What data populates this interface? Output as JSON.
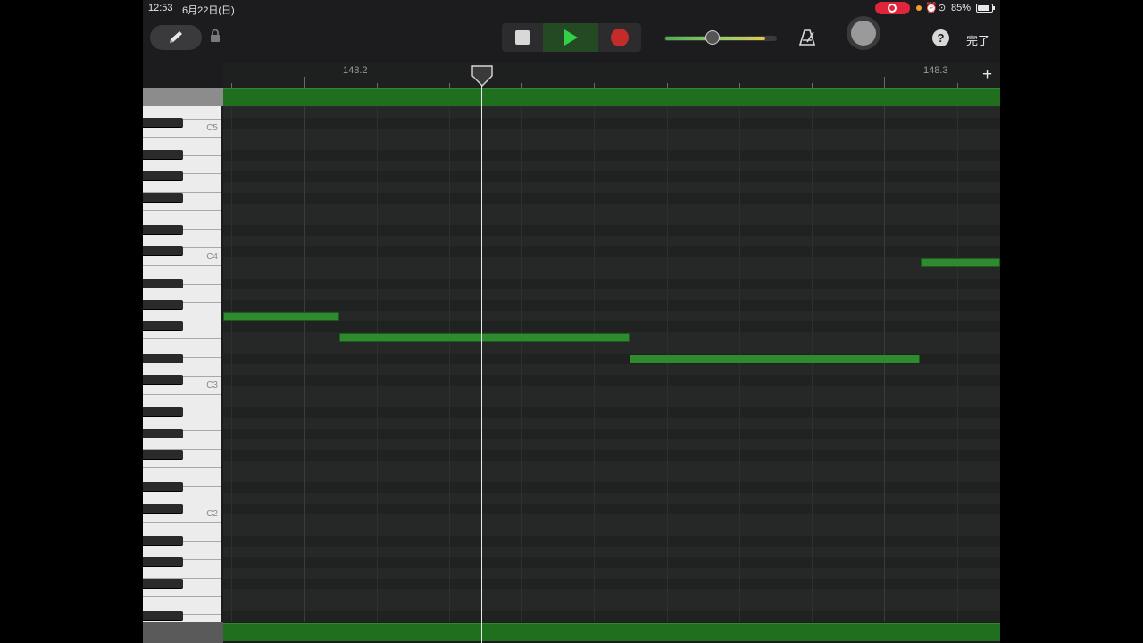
{
  "status_bar": {
    "time": "12:53",
    "date": "6月22日(日)",
    "battery_percent": "85%",
    "battery_level": 0.85
  },
  "toolbar": {
    "done_label": "完了",
    "help_label": "?",
    "volume_level": 0.44
  },
  "ruler": {
    "bar_labels": [
      "148.2",
      "148.3"
    ],
    "add_label": "+"
  },
  "piano": {
    "octave_labels": [
      "C5",
      "C4",
      "C3",
      "C2"
    ]
  },
  "colors": {
    "note": "#2e8b2e",
    "region": "#1f6f1f",
    "play": "#33d04a",
    "record": "#c42b2b",
    "status_record": "#e0243a"
  }
}
